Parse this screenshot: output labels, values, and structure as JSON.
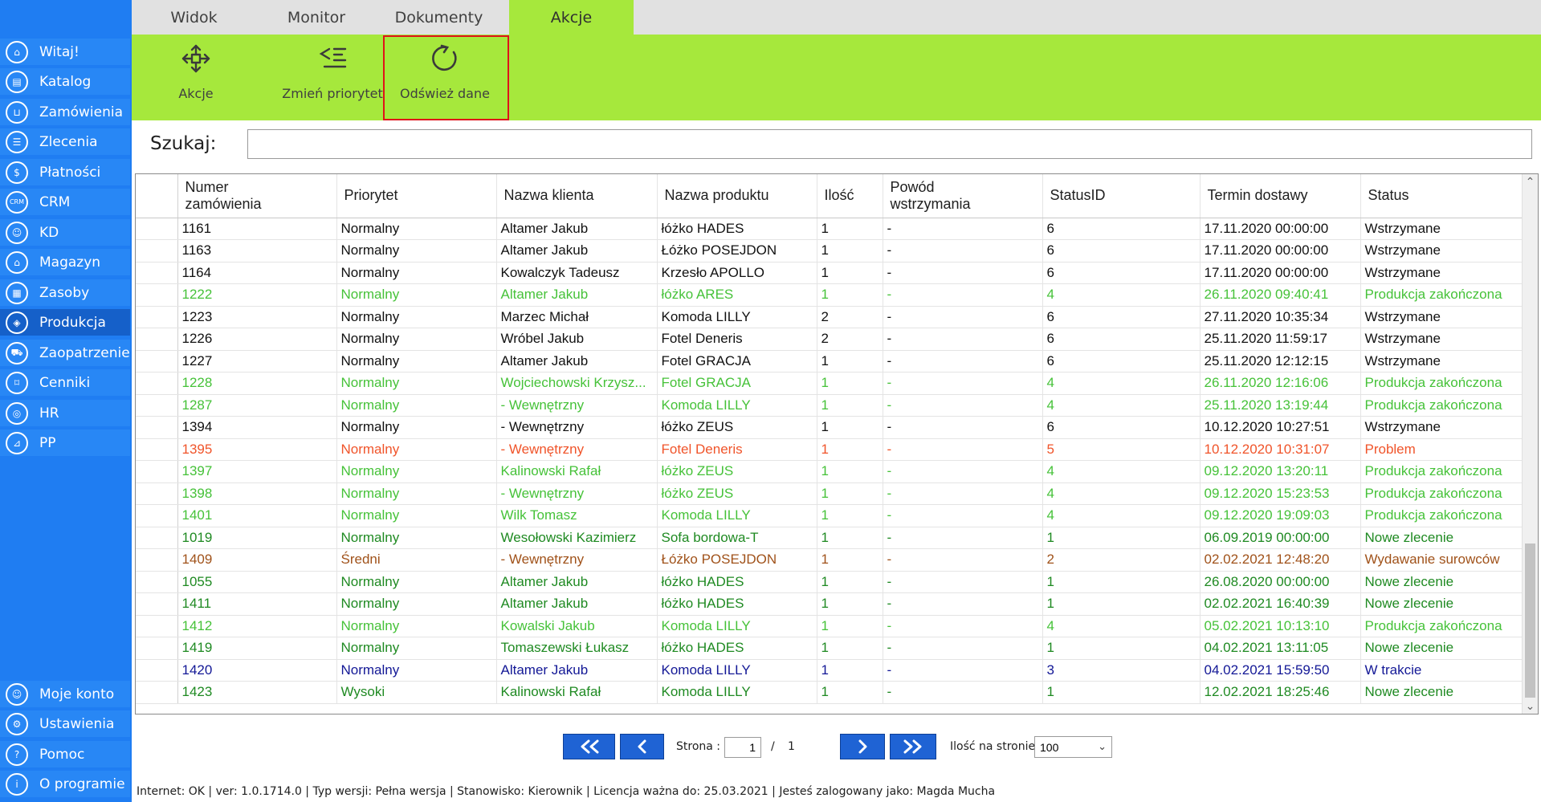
{
  "sidebar": {
    "items": [
      {
        "label": "Witaj!",
        "icon": "home-icon",
        "glyph": "⌂"
      },
      {
        "label": "Katalog",
        "icon": "book-icon",
        "glyph": "▤"
      },
      {
        "label": "Zamówienia",
        "icon": "cart-icon",
        "glyph": "⊔"
      },
      {
        "label": "Zlecenia",
        "icon": "list-icon",
        "glyph": "☰"
      },
      {
        "label": "Płatności",
        "icon": "dollar-icon",
        "glyph": "$"
      },
      {
        "label": "CRM",
        "icon": "crm-icon",
        "glyph": "CRM"
      },
      {
        "label": "KD",
        "icon": "person-icon",
        "glyph": "☺"
      },
      {
        "label": "Magazyn",
        "icon": "warehouse-icon",
        "glyph": "⌂"
      },
      {
        "label": "Zasoby",
        "icon": "resources-icon",
        "glyph": "▦"
      },
      {
        "label": "Produkcja",
        "icon": "production-icon",
        "glyph": "◈"
      },
      {
        "label": "Zaopatrzenie",
        "icon": "truck-icon",
        "glyph": "⛟"
      },
      {
        "label": "Cenniki",
        "icon": "tag-icon",
        "glyph": "⌑"
      },
      {
        "label": "HR",
        "icon": "hr-icon",
        "glyph": "◎"
      },
      {
        "label": "PP",
        "icon": "pp-icon",
        "glyph": "⊿"
      }
    ],
    "bottom_items": [
      {
        "label": "Moje konto",
        "icon": "user-icon",
        "glyph": "☺"
      },
      {
        "label": "Ustawienia",
        "icon": "gear-icon",
        "glyph": "⚙"
      },
      {
        "label": "Pomoc",
        "icon": "help-icon",
        "glyph": "?"
      },
      {
        "label": "O programie",
        "icon": "info-icon",
        "glyph": "i"
      }
    ],
    "active_label": "Produkcja",
    "colors": {
      "background": "#1f7df2",
      "item": "#2887f5",
      "active": "#1560c9"
    }
  },
  "tabs": {
    "items": [
      "Widok",
      "Monitor",
      "Dokumenty",
      "Akcje"
    ],
    "active": "Akcje"
  },
  "ribbon": {
    "buttons": {
      "actions": "Akcje",
      "priority": "Zmień priorytet",
      "refresh": "Odśwież dane"
    },
    "highlighted": "Odśwież dane",
    "colors": {
      "background": "#a6e83c",
      "highlight": "#e0121a"
    }
  },
  "search": {
    "label": "Szukaj:",
    "value": "",
    "placeholder": ""
  },
  "table": {
    "headers": {
      "order_no_1": "Numer",
      "order_no_2": "zamówienia",
      "priority": "Priorytet",
      "client": "Nazwa klienta",
      "product": "Nazwa produktu",
      "qty": "Ilość",
      "reason_1": "Powód",
      "reason_2": "wstrzymania",
      "status_id": "StatusID",
      "deadline": "Termin dostawy",
      "status": "Status"
    },
    "rows": [
      {
        "color": "black",
        "cells": [
          "1161",
          "Normalny",
          "Altamer Jakub",
          "łóżko HADES",
          "1",
          "-",
          "6",
          "17.11.2020 00:00:00",
          "Wstrzymane"
        ]
      },
      {
        "color": "black",
        "cells": [
          "1163",
          "Normalny",
          "Altamer Jakub",
          "Łóżko POSEJDON",
          "1",
          "-",
          "6",
          "17.11.2020 00:00:00",
          "Wstrzymane"
        ]
      },
      {
        "color": "black",
        "cells": [
          "1164",
          "Normalny",
          "Kowalczyk Tadeusz",
          "Krzesło APOLLO",
          "1",
          "-",
          "6",
          "17.11.2020 00:00:00",
          "Wstrzymane"
        ]
      },
      {
        "color": "green",
        "cells": [
          "1222",
          "Normalny",
          "Altamer Jakub",
          "łóżko ARES",
          "1",
          "-",
          "4",
          "26.11.2020 09:40:41",
          "Produkcja zakończona"
        ]
      },
      {
        "color": "black",
        "cells": [
          "1223",
          "Normalny",
          "Marzec Michał",
          "Komoda LILLY",
          "2",
          "-",
          "6",
          "27.11.2020 10:35:34",
          "Wstrzymane"
        ]
      },
      {
        "color": "black",
        "cells": [
          "1226",
          "Normalny",
          "Wróbel Jakub",
          "Fotel Deneris",
          "2",
          "-",
          "6",
          "25.11.2020 11:59:17",
          "Wstrzymane"
        ]
      },
      {
        "color": "black",
        "cells": [
          "1227",
          "Normalny",
          "Altamer Jakub",
          "Fotel GRACJA",
          "1",
          "-",
          "6",
          "25.11.2020 12:12:15",
          "Wstrzymane"
        ]
      },
      {
        "color": "green",
        "cells": [
          "1228",
          "Normalny",
          "Wojciechowski Krzysz...",
          "Fotel GRACJA",
          "1",
          "-",
          "4",
          "26.11.2020 12:16:06",
          "Produkcja zakończona"
        ]
      },
      {
        "color": "green",
        "cells": [
          "1287",
          "Normalny",
          "- Wewnętrzny",
          "Komoda LILLY",
          "1",
          "-",
          "4",
          "25.11.2020 13:19:44",
          "Produkcja zakończona"
        ]
      },
      {
        "color": "black",
        "cells": [
          "1394",
          "Normalny",
          "- Wewnętrzny",
          "łóżko ZEUS",
          "1",
          "-",
          "6",
          "10.12.2020 10:27:51",
          "Wstrzymane"
        ]
      },
      {
        "color": "red",
        "cells": [
          "1395",
          "Normalny",
          "- Wewnętrzny",
          "Fotel Deneris",
          "1",
          "-",
          "5",
          "10.12.2020 10:31:07",
          "Problem"
        ]
      },
      {
        "color": "green",
        "cells": [
          "1397",
          "Normalny",
          "Kalinowski Rafał",
          "łóżko ZEUS",
          "1",
          "-",
          "4",
          "09.12.2020 13:20:11",
          "Produkcja zakończona"
        ]
      },
      {
        "color": "green",
        "cells": [
          "1398",
          "Normalny",
          "- Wewnętrzny",
          "łóżko ZEUS",
          "1",
          "-",
          "4",
          "09.12.2020 15:23:53",
          "Produkcja zakończona"
        ]
      },
      {
        "color": "green",
        "cells": [
          "1401",
          "Normalny",
          "Wilk Tomasz",
          "Komoda LILLY",
          "1",
          "-",
          "4",
          "09.12.2020 19:09:03",
          "Produkcja zakończona"
        ]
      },
      {
        "color": "dgreen",
        "cells": [
          "1019",
          "Normalny",
          "Wesołowski Kazimierz",
          "Sofa bordowa-T",
          "1",
          "-",
          "1",
          "06.09.2019 00:00:00",
          "Nowe zlecenie"
        ]
      },
      {
        "color": "brown",
        "cells": [
          "1409",
          "Średni",
          "- Wewnętrzny",
          "Łóżko POSEJDON",
          "1",
          "-",
          "2",
          "02.02.2021 12:48:20",
          "Wydawanie surowców"
        ]
      },
      {
        "color": "dgreen",
        "cells": [
          "1055",
          "Normalny",
          "Altamer Jakub",
          "łóżko HADES",
          "1",
          "-",
          "1",
          "26.08.2020 00:00:00",
          "Nowe zlecenie"
        ]
      },
      {
        "color": "dgreen",
        "cells": [
          "1411",
          "Normalny",
          "Altamer Jakub",
          "łóżko HADES",
          "1",
          "-",
          "1",
          "02.02.2021 16:40:39",
          "Nowe zlecenie"
        ]
      },
      {
        "color": "green",
        "cells": [
          "1412",
          "Normalny",
          "Kowalski Jakub",
          "Komoda LILLY",
          "1",
          "-",
          "4",
          "05.02.2021 10:13:10",
          "Produkcja zakończona"
        ]
      },
      {
        "color": "dgreen",
        "cells": [
          "1419",
          "Normalny",
          "Tomaszewski Łukasz",
          "łóżko HADES",
          "1",
          "-",
          "1",
          "04.02.2021 13:11:05",
          "Nowe zlecenie"
        ]
      },
      {
        "color": "navy",
        "cells": [
          "1420",
          "Normalny",
          "Altamer Jakub",
          "Komoda LILLY",
          "1",
          "-",
          "3",
          "04.02.2021 15:59:50",
          "W trakcie"
        ]
      },
      {
        "color": "dgreen",
        "cells": [
          "1423",
          "Wysoki",
          "Kalinowski Rafał",
          "Komoda LILLY",
          "1",
          "-",
          "1",
          "12.02.2021 18:25:46",
          "Nowe zlecenie"
        ]
      }
    ]
  },
  "pager": {
    "page_label": "Strona :",
    "page_value": "1",
    "separator": "/",
    "total_pages": "1",
    "page_size_label": "Ilość na stronie:",
    "page_size_value": "100"
  },
  "statusbar": {
    "text": "Internet: OK  |   ver: 1.0.1714.0   |   Typ wersji: Pełna wersja   |   Stanowisko: Kierownik   |   Licencja ważna do: 25.03.2021   |   Jesteś zalogowany jako: Magda Mucha"
  }
}
